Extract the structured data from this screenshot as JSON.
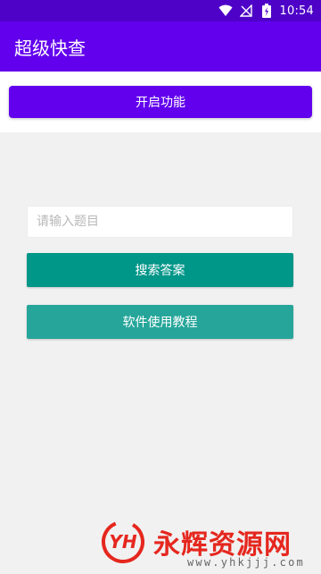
{
  "status_bar": {
    "time": "10:54",
    "icons": [
      "wifi-icon",
      "signal-icon",
      "battery-icon"
    ]
  },
  "app_bar": {
    "title": "超级快查"
  },
  "action_strip": {
    "enable_button_label": "开启功能"
  },
  "search": {
    "placeholder": "请输入题目",
    "value": ""
  },
  "buttons": {
    "search_label": "搜索答案",
    "tutorial_label": "软件使用教程"
  },
  "watermark": {
    "logo_text": "YH",
    "title": "永辉资源网",
    "url": "www.yhkjjj.com"
  },
  "colors": {
    "status_bar": "#4e02c7",
    "primary": "#6200ee",
    "search_button": "#009688",
    "tutorial_button": "#26a69a",
    "background": "#f1f1f1",
    "watermark_red": "#e5271e"
  }
}
